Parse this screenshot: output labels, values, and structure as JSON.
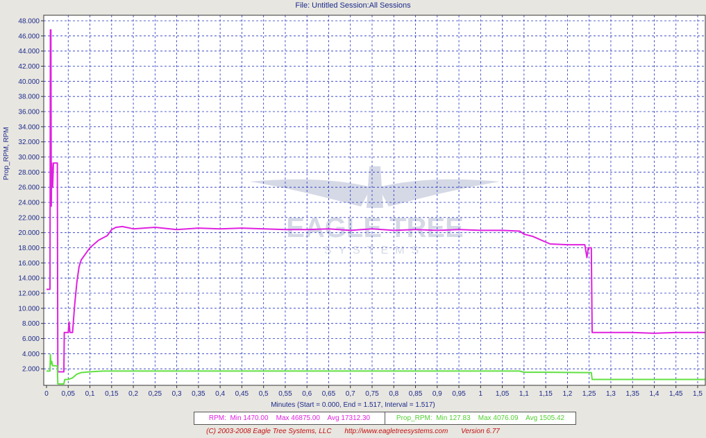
{
  "header": {
    "title": "File: Untitled   Session:All Sessions"
  },
  "chart_data": {
    "type": "line",
    "title": "File: Untitled   Session:All Sessions",
    "xlabel": "Minutes (Start = 0.000,  End = 1.517,  Interval = 1.517)",
    "ylabel": "Prop_RPM, RPM",
    "xlim": [
      0,
      1.517
    ],
    "ylim": [
      0,
      48000
    ],
    "x_ticks": [
      "0",
      "0,05",
      "0,1",
      "0,15",
      "0,2",
      "0,25",
      "0,3",
      "0,35",
      "0,4",
      "0,45",
      "0,5",
      "0,55",
      "0,6",
      "0,65",
      "0,7",
      "0,75",
      "0,8",
      "0,85",
      "0,9",
      "0,95",
      "1",
      "1,05",
      "1,1",
      "1,15",
      "1,2",
      "1,25",
      "1,3",
      "1,35",
      "1,4",
      "1,45",
      "1,5"
    ],
    "y_ticks": [
      "2.000",
      "4.000",
      "6.000",
      "8.000",
      "10.000",
      "12.000",
      "14.000",
      "16.000",
      "18.000",
      "20.000",
      "22.000",
      "24.000",
      "26.000",
      "28.000",
      "30.000",
      "32.000",
      "34.000",
      "36.000",
      "38.000",
      "40.000",
      "42.000",
      "44.000",
      "46.000",
      "48.000"
    ],
    "grid": true,
    "series": [
      {
        "name": "RPM",
        "color": "#e020e0",
        "points": [
          [
            0,
            12500
          ],
          [
            0.008,
            12500
          ],
          [
            0.009,
            46800
          ],
          [
            0.01,
            46800
          ],
          [
            0.011,
            23500
          ],
          [
            0.012,
            29200
          ],
          [
            0.014,
            26000
          ],
          [
            0.016,
            29200
          ],
          [
            0.025,
            29200
          ],
          [
            0.026,
            1600
          ],
          [
            0.04,
            1600
          ],
          [
            0.041,
            6800
          ],
          [
            0.05,
            6800
          ],
          [
            0.052,
            8200
          ],
          [
            0.054,
            6800
          ],
          [
            0.06,
            6800
          ],
          [
            0.065,
            10500
          ],
          [
            0.07,
            13500
          ],
          [
            0.075,
            15500
          ],
          [
            0.08,
            16400
          ],
          [
            0.09,
            17200
          ],
          [
            0.1,
            18000
          ],
          [
            0.11,
            18500
          ],
          [
            0.12,
            19000
          ],
          [
            0.13,
            19300
          ],
          [
            0.14,
            19600
          ],
          [
            0.15,
            20400
          ],
          [
            0.16,
            20700
          ],
          [
            0.175,
            20800
          ],
          [
            0.2,
            20500
          ],
          [
            0.25,
            20700
          ],
          [
            0.3,
            20400
          ],
          [
            0.35,
            20600
          ],
          [
            0.4,
            20500
          ],
          [
            0.45,
            20600
          ],
          [
            0.5,
            20500
          ],
          [
            0.55,
            20400
          ],
          [
            0.6,
            20400
          ],
          [
            0.65,
            20500
          ],
          [
            0.7,
            20300
          ],
          [
            0.75,
            20500
          ],
          [
            0.8,
            20300
          ],
          [
            0.85,
            20400
          ],
          [
            0.9,
            20300
          ],
          [
            0.95,
            20400
          ],
          [
            1.0,
            20300
          ],
          [
            1.05,
            20300
          ],
          [
            1.09,
            20200
          ],
          [
            1.1,
            19800
          ],
          [
            1.12,
            19500
          ],
          [
            1.14,
            19000
          ],
          [
            1.16,
            18500
          ],
          [
            1.2,
            18400
          ],
          [
            1.24,
            18400
          ],
          [
            1.245,
            16700
          ],
          [
            1.248,
            18000
          ],
          [
            1.255,
            18000
          ],
          [
            1.257,
            6800
          ],
          [
            1.3,
            6800
          ],
          [
            1.35,
            6800
          ],
          [
            1.4,
            6700
          ],
          [
            1.45,
            6800
          ],
          [
            1.517,
            6800
          ]
        ]
      },
      {
        "name": "Prop_RPM",
        "color": "#60e040",
        "points": [
          [
            0,
            1700
          ],
          [
            0.008,
            1700
          ],
          [
            0.009,
            3900
          ],
          [
            0.01,
            2600
          ],
          [
            0.012,
            3000
          ],
          [
            0.014,
            2400
          ],
          [
            0.025,
            2400
          ],
          [
            0.026,
            0
          ],
          [
            0.04,
            0
          ],
          [
            0.042,
            600
          ],
          [
            0.05,
            600
          ],
          [
            0.06,
            800
          ],
          [
            0.07,
            1300
          ],
          [
            0.08,
            1500
          ],
          [
            0.1,
            1600
          ],
          [
            0.13,
            1700
          ],
          [
            0.2,
            1700
          ],
          [
            0.5,
            1700
          ],
          [
            0.8,
            1700
          ],
          [
            1.09,
            1700
          ],
          [
            1.1,
            1550
          ],
          [
            1.15,
            1550
          ],
          [
            1.24,
            1500
          ],
          [
            1.255,
            1500
          ],
          [
            1.257,
            600
          ],
          [
            1.517,
            600
          ]
        ]
      }
    ],
    "legend": [
      {
        "text": "RPM:  Min 1470.00    Max 46875.00    Avg 17312.30",
        "color": "#e020e0"
      },
      {
        "text": "Prop_RPM:  Min 127.83    Max 4076.09    Avg 1505.42",
        "color": "#50d030"
      }
    ]
  },
  "footer": {
    "copyright": "(C) 2003-2008 Eagle Tree Systems, LLC",
    "url": "http://www.eagletreesystems.com",
    "version": "Version 6.77"
  },
  "watermark": {
    "text": "EAGLE TREE",
    "subtext": "SYSTEMS"
  }
}
